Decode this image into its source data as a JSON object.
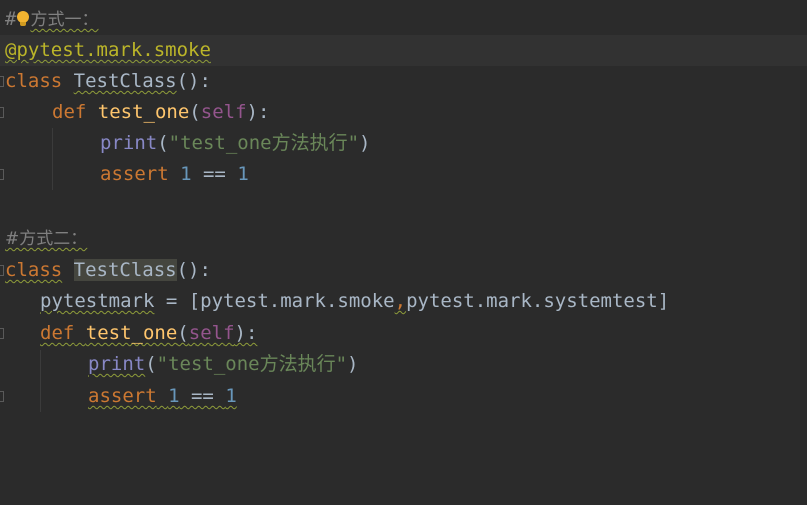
{
  "editor": {
    "lines": {
      "l1": {
        "hash": "#",
        "comment_text": "方式一："
      },
      "l2": {
        "decorator": "@pytest.mark.smoke"
      },
      "l3": {
        "kw": "class",
        "name": "TestClass",
        "punct": "():"
      },
      "l4": {
        "kw": "def",
        "name": "test_one",
        "open": "(",
        "self": "self",
        "close": "):"
      },
      "l5": {
        "fn": "print",
        "open": "(",
        "str": "\"test_one方法执行\"",
        "close": ")"
      },
      "l6": {
        "kw": "assert",
        "n1": "1",
        "op": " == ",
        "n2": "1"
      },
      "l8": {
        "comment": "#方式二："
      },
      "l9": {
        "kw": "class",
        "name": "TestClass",
        "punct": "():"
      },
      "l10": {
        "var": "pytestmark",
        "rest1": " = [pytest.mark.smoke",
        "comma": ",",
        "rest2": "pytest.mark.systemtest]"
      },
      "l11": {
        "kw": "def",
        "name": "test_one",
        "open": "(",
        "self": "self",
        "close": "):"
      },
      "l12": {
        "fn": "print",
        "open": "(",
        "str": "\"test_one方法执行\"",
        "close": ")"
      },
      "l13": {
        "kw": "assert",
        "n1": "1",
        "op": " == ",
        "n2": "1"
      }
    },
    "colors": {
      "background": "#2b2b2b",
      "keyword": "#cc7832",
      "function": "#ffc66d",
      "self": "#94558d",
      "builtin": "#8888c6",
      "string": "#6a8759",
      "number": "#6897bb",
      "decorator": "#bbb529",
      "comment": "#808080"
    },
    "icons": [
      "lightbulb-icon",
      "fold-marker-icon"
    ]
  }
}
